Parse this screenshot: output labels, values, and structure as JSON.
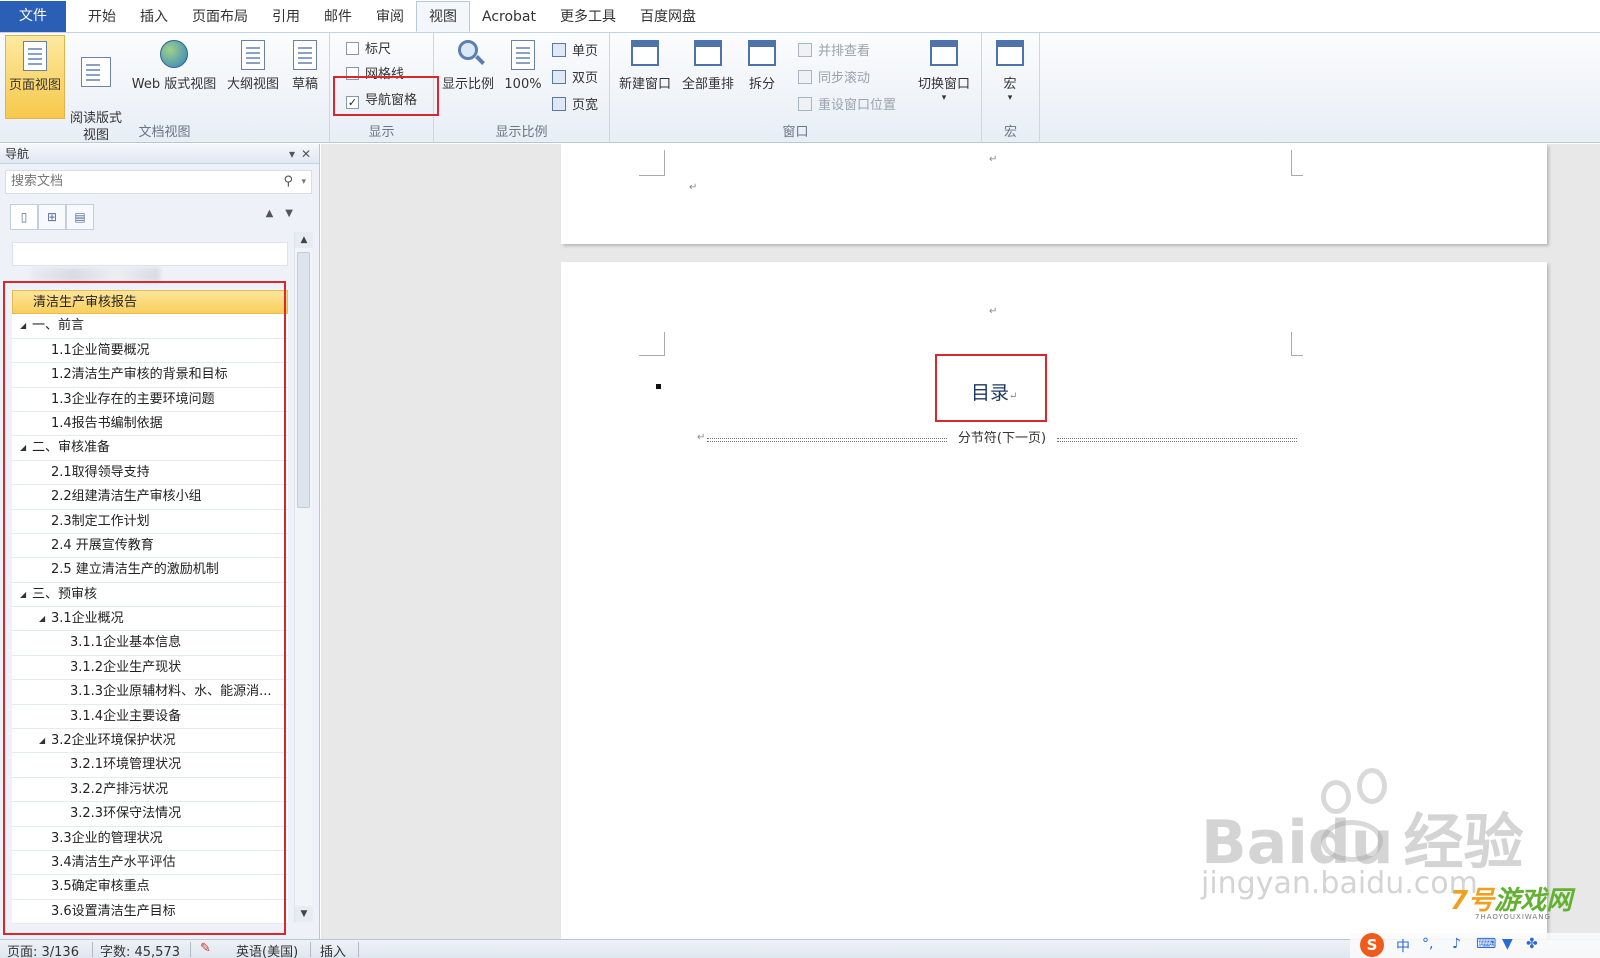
{
  "menu": {
    "tabs": [
      "文件",
      "开始",
      "插入",
      "页面布局",
      "引用",
      "邮件",
      "审阅",
      "视图",
      "Acrobat",
      "更多工具",
      "百度网盘"
    ],
    "active": "视图"
  },
  "ribbon": {
    "views_group": {
      "label": "文档视图",
      "buttons": [
        "页面视图",
        "阅读版式\n视图",
        "Web 版式视图",
        "大纲视图",
        "草稿"
      ]
    },
    "show_group": {
      "label": "显示",
      "ruler": "标尺",
      "gridlines": "网格线",
      "nav_pane": "导航窗格",
      "nav_pane_checked": true
    },
    "zoom_group": {
      "label": "显示比例",
      "zoom": "显示比例",
      "percent": "100%",
      "one_page": "单页",
      "two_pages": "双页",
      "page_width": "页宽"
    },
    "window_group": {
      "label": "窗口",
      "new_window": "新建窗口",
      "arrange_all": "全部重排",
      "split": "拆分",
      "side_by_side": "并排查看",
      "sync_scroll": "同步滚动",
      "reset_position": "重设窗口位置",
      "switch_windows": "切换窗口"
    },
    "macro_group": {
      "label": "宏",
      "macros": "宏"
    }
  },
  "nav": {
    "title": "导航",
    "search_placeholder": "搜索文档",
    "outline": [
      {
        "text": "清洁生产审核报告",
        "level": 0,
        "expanded": null,
        "highlighted": true
      },
      {
        "text": "一、前言",
        "level": 0,
        "expanded": true
      },
      {
        "text": "1.1企业简要概况",
        "level": 1
      },
      {
        "text": "1.2清洁生产审核的背景和目标",
        "level": 1
      },
      {
        "text": "1.3企业存在的主要环境问题",
        "level": 1
      },
      {
        "text": "1.4报告书编制依据",
        "level": 1
      },
      {
        "text": "二、审核准备",
        "level": 0,
        "expanded": true
      },
      {
        "text": "2.1取得领导支持",
        "level": 1
      },
      {
        "text": "2.2组建清洁生产审核小组",
        "level": 1
      },
      {
        "text": "2.3制定工作计划",
        "level": 1
      },
      {
        "text": "2.4 开展宣传教育",
        "level": 1
      },
      {
        "text": "2.5 建立清洁生产的激励机制",
        "level": 1
      },
      {
        "text": "三、预审核",
        "level": 0,
        "expanded": true
      },
      {
        "text": "3.1企业概况",
        "level": 1,
        "expanded": true
      },
      {
        "text": "3.1.1企业基本信息",
        "level": 2
      },
      {
        "text": "3.1.2企业生产现状",
        "level": 2
      },
      {
        "text": "3.1.3企业原辅材料、水、能源消...",
        "level": 2
      },
      {
        "text": "3.1.4企业主要设备",
        "level": 2
      },
      {
        "text": "3.2企业环境保护状况",
        "level": 1,
        "expanded": true
      },
      {
        "text": "3.2.1环境管理状况",
        "level": 2
      },
      {
        "text": "3.2.2产排污状况",
        "level": 2
      },
      {
        "text": "3.2.3环保守法情况",
        "level": 2
      },
      {
        "text": "3.3企业的管理状况",
        "level": 1
      },
      {
        "text": "3.4清洁生产水平评估",
        "level": 1
      },
      {
        "text": "3.5确定审核重点",
        "level": 1
      },
      {
        "text": "3.6设置清洁生产目标",
        "level": 1
      }
    ]
  },
  "document": {
    "toc_title": "目录",
    "section_break": "分节符(下一页)"
  },
  "status": {
    "page": "页面: 3/136",
    "words": "字数: 45,573",
    "language": "英语(美国)",
    "mode": "插入"
  },
  "watermarks": {
    "baidu": "Baidu",
    "jingyan": "经验",
    "domain": "jingyan.baidu.com",
    "site_seven": "7号",
    "site_name": "游戏网",
    "site_sub": "7HAOYOUXIWANG"
  },
  "ime": {
    "s": "S",
    "lang": "中",
    "punct": "°,"
  },
  "colors": {
    "file_tab": "#2b5fb5",
    "highlight": "#f9cf5c",
    "red_annotation": "#d9272e",
    "toc_title": "#1f3864"
  }
}
